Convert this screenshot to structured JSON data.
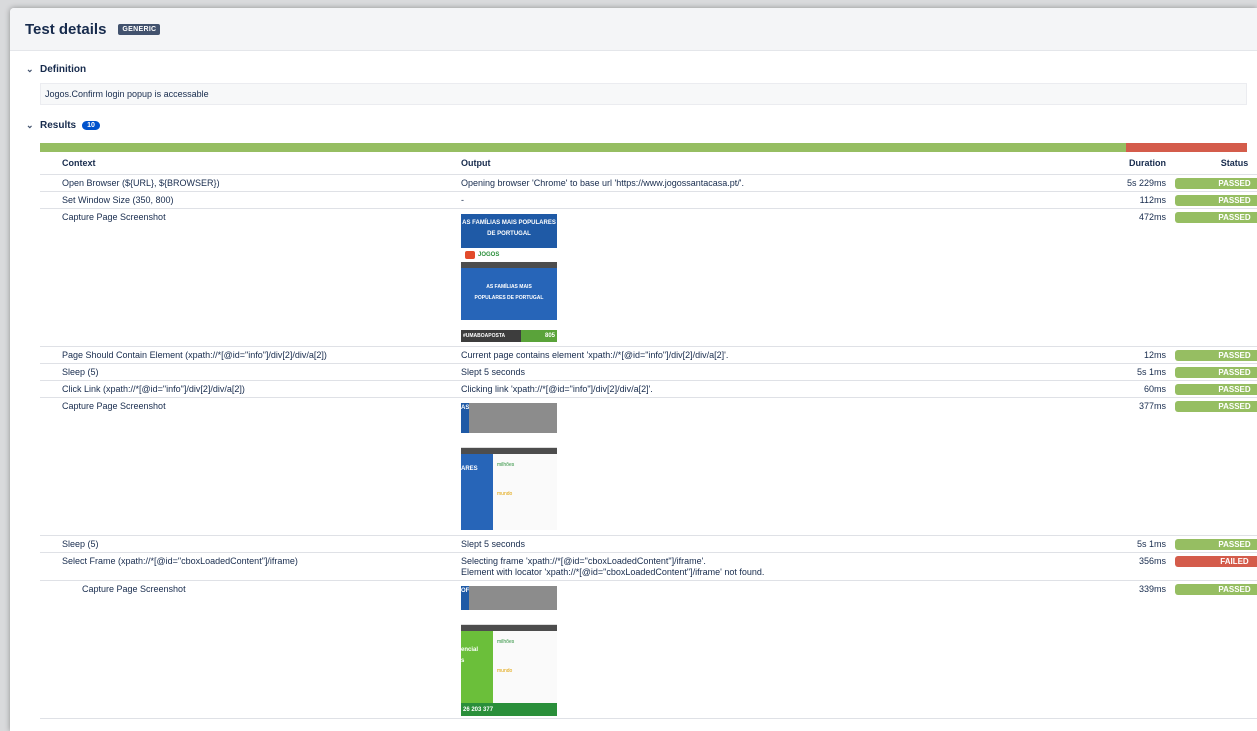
{
  "header": {
    "title": "Test details",
    "badge": "GENERIC"
  },
  "definition": {
    "label": "Definition",
    "text": "Jogos.Confirm login popup is accessable"
  },
  "results": {
    "label": "Results",
    "count": "10",
    "pass_fraction": 0.9,
    "columns": {
      "context": "Context",
      "output": "Output",
      "duration": "Duration",
      "status": "Status"
    },
    "rows": [
      {
        "context": "Open Browser (${URL}, ${BROWSER})",
        "output": "Opening browser 'Chrome' to base url 'https://www.jogossantacasa.pt/'.",
        "output2": "",
        "duration": "5s 229ms",
        "status": "PASSED",
        "shot": ""
      },
      {
        "context": "Set Window Size (350, 800)",
        "output": "-",
        "output2": "",
        "duration": "112ms",
        "status": "PASSED",
        "shot": ""
      },
      {
        "context": "Capture Page Screenshot",
        "output": "",
        "output2": "",
        "duration": "472ms",
        "status": "PASSED",
        "shot": "1"
      },
      {
        "context": "Page Should Contain Element (xpath://*[@id=\"info\"]/div[2]/div/a[2])",
        "output": "Current page contains element 'xpath://*[@id=\"info\"]/div[2]/div/a[2]'.",
        "output2": "",
        "duration": "12ms",
        "status": "PASSED",
        "shot": ""
      },
      {
        "context": "Sleep (5)",
        "output": "Slept 5 seconds",
        "output2": "",
        "duration": "5s 1ms",
        "status": "PASSED",
        "shot": ""
      },
      {
        "context": "Click Link (xpath://*[@id=\"info\"]/div[2]/div/a[2])",
        "output": "Clicking link 'xpath://*[@id=\"info\"]/div[2]/div/a[2]'.",
        "output2": "",
        "duration": "60ms",
        "status": "PASSED",
        "shot": ""
      },
      {
        "context": "Capture Page Screenshot",
        "output": "",
        "output2": "",
        "duration": "377ms",
        "status": "PASSED",
        "shot": "2"
      },
      {
        "context": "Sleep (5)",
        "output": "Slept 5 seconds",
        "output2": "",
        "duration": "5s 1ms",
        "status": "PASSED",
        "shot": ""
      },
      {
        "context": "Select Frame (xpath://*[@id=\"cboxLoadedContent\"]/iframe)",
        "output": "Selecting frame 'xpath://*[@id=\"cboxLoadedContent\"]/iframe'.",
        "output2": "Element with locator 'xpath://*[@id=\"cboxLoadedContent\"]/iframe' not found.",
        "duration": "356ms",
        "status": "FAILED",
        "shot": ""
      },
      {
        "context": "Capture Page Screenshot",
        "output": "",
        "output2": "",
        "duration": "339ms",
        "status": "PASSED",
        "shot": "3",
        "indent": true
      }
    ]
  },
  "screenshots": {
    "s1": {
      "headline": "AS FAMÍLIAS MAIS POPULARES DE PORTUGAL",
      "logo": "JOGOS",
      "banner": "AS FAMÍLIAS MAIS POPULARES DE PORTUGAL",
      "footer": "#UMABOAPOSTA",
      "footer2": "805"
    },
    "s2": {
      "headline": "AS",
      "side": "ARES",
      "mark1": "milhões",
      "mark2": "mundo"
    },
    "s3": {
      "headline": "OF",
      "side": "encial",
      "side2": "s",
      "footer": "26 203 377",
      "mark1": "milhões",
      "mark2": "mundo"
    }
  },
  "colors": {
    "passed": "#96be62",
    "failed": "#d45c4b",
    "accent": "#0052cc",
    "brand_blue": "#1f5aa6"
  }
}
